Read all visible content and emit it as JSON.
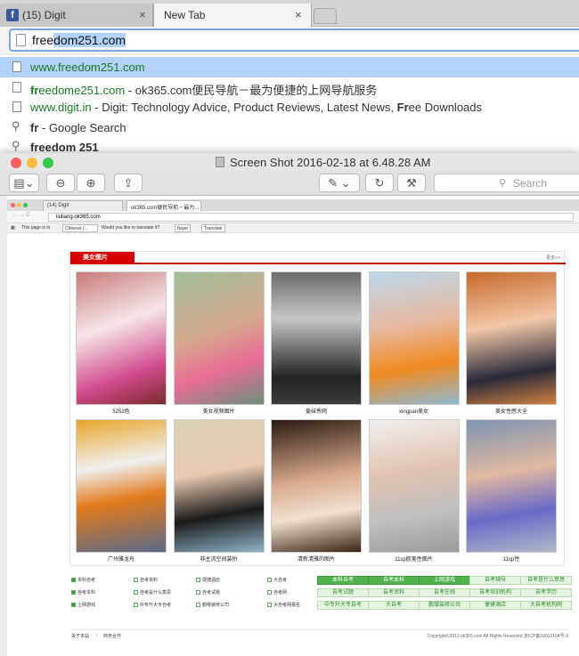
{
  "tabs": [
    {
      "label": "(15) Digit",
      "icon": "facebook-icon"
    },
    {
      "label": "New Tab"
    }
  ],
  "omnibox": {
    "prefix": "free",
    "selected": "dom251.com"
  },
  "suggestions": [
    {
      "text": "www.freedom251.com"
    },
    {
      "pre": "fr",
      "text": "eedome251.com",
      "desc": " - ok365.com便民导航－最为便捷的上网导航服务"
    },
    {
      "url": "www.digit.in",
      "desc": " - Digit: Technology Advice, Product Reviews, Latest News, ",
      "bold": "Fr",
      "rest": "ee Downloads"
    },
    {
      "bold": "fr",
      "rest": " - Google Search"
    },
    {
      "bold": "freedom 251",
      "rest": ""
    }
  ],
  "preview": {
    "title": "Screen Shot 2016-02-18 at 6.48.28 AM",
    "search_placeholder": "Search",
    "colors": {
      "red": "#fc605c",
      "yellow": "#fdbc40",
      "green": "#34c84a"
    }
  },
  "inner": {
    "tab1": "(14) Digit",
    "tab2": "ok365.com便民导航－最为...",
    "url": "liuliang.ok365.com",
    "translate": {
      "prefix": "This page is in",
      "lang": "Chinese (...",
      "question": "Would you like to translate it?",
      "nope": "Nope",
      "translate": "Translate"
    }
  },
  "section": {
    "title": "美女图片",
    "more": "更多>>"
  },
  "gallery": [
    {
      "caption": "5252色"
    },
    {
      "caption": "美女视频图片"
    },
    {
      "caption": "姜妹秀网"
    },
    {
      "caption": "xingpan美女"
    },
    {
      "caption": "美女性感大全"
    },
    {
      "caption": "广州雅龙舟"
    },
    {
      "caption": "非主流空间装扮"
    },
    {
      "caption": "清新清雅的图片"
    },
    {
      "caption": "11sp欧美性图片"
    },
    {
      "caption": "11sp性"
    }
  ],
  "links": {
    "row1": [
      "本科自考",
      "自考资料",
      "便捷酒店",
      "大自考"
    ],
    "row2": [
      "自考本科",
      "自考是什么意思",
      "自考试题",
      "自考网"
    ],
    "row3": [
      "上网游戏",
      "中专升大专自考",
      "鹏缨装修公司",
      "大自考网报名",
      "自考培训机构"
    ],
    "green": [
      [
        "本科自考",
        "自考本科",
        "上网游戏",
        "自考辅导",
        "自考是什么意思"
      ],
      [
        "自考试题",
        "自考资料",
        "自考在线",
        "自考培训机构",
        "自考学历"
      ],
      [
        "中专升大专自考",
        "大自考",
        "鹏缨装修公司",
        "便捷酒店",
        "大自考机构网"
      ]
    ]
  },
  "footer": {
    "about": "关于本站",
    "biz": "商务合作",
    "copyright": "Copyright©2013 ok365.com All Rights Reserved 京ICP备10012104号-9"
  }
}
